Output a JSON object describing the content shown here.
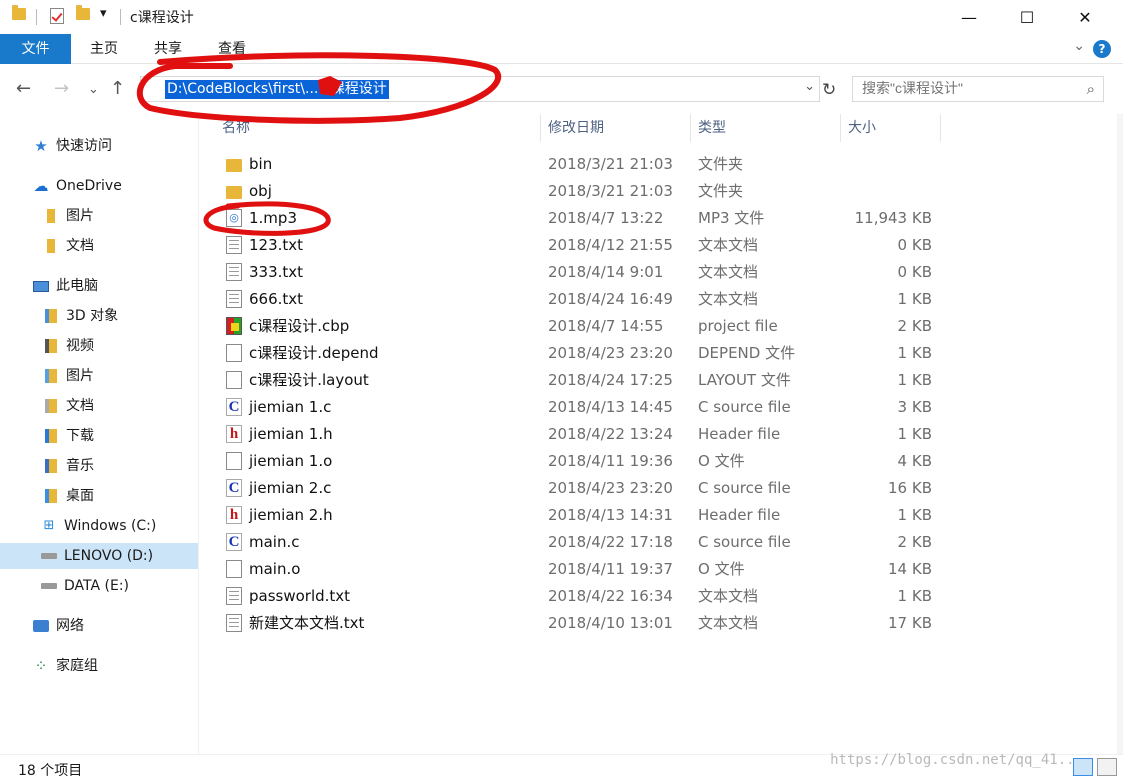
{
  "window": {
    "title": "c课程设计",
    "min": "—",
    "max": "☐",
    "close": "✕",
    "quick_access_dropdown": "▾"
  },
  "ribbon": {
    "tabs": [
      "文件",
      "主页",
      "共享",
      "查看"
    ],
    "help": "?",
    "collapse": "⌄"
  },
  "address": {
    "path": "D:\\CodeBlocks\\first\\...\\c课程设计",
    "dropdown": "⌄"
  },
  "search": {
    "placeholder": "搜索\"c课程设计\""
  },
  "sidebar": {
    "items": [
      {
        "label": "快速访问",
        "icon": "star-icon"
      },
      {
        "label": "OneDrive",
        "icon": "cloud-icon"
      },
      {
        "label": "图片",
        "icon": "folder-icon"
      },
      {
        "label": "文档",
        "icon": "folder-icon"
      },
      {
        "label": "此电脑",
        "icon": "computer-icon"
      },
      {
        "label": "3D 对象",
        "icon": "cube-folder-icon"
      },
      {
        "label": "视频",
        "icon": "video-folder-icon"
      },
      {
        "label": "图片",
        "icon": "picture-folder-icon"
      },
      {
        "label": "文档",
        "icon": "document-folder-icon"
      },
      {
        "label": "下载",
        "icon": "download-folder-icon"
      },
      {
        "label": "音乐",
        "icon": "music-folder-icon"
      },
      {
        "label": "桌面",
        "icon": "desktop-folder-icon"
      },
      {
        "label": "Windows (C:)",
        "icon": "windows-drive-icon"
      },
      {
        "label": "LENOVO (D:)",
        "icon": "drive-icon"
      },
      {
        "label": "DATA (E:)",
        "icon": "drive-icon"
      },
      {
        "label": "网络",
        "icon": "network-icon"
      },
      {
        "label": "家庭组",
        "icon": "homegroup-icon"
      }
    ]
  },
  "columns": [
    "名称",
    "修改日期",
    "类型",
    "大小"
  ],
  "files": [
    {
      "name": "bin",
      "date": "2018/3/21 21:03",
      "type": "文件夹",
      "size": "",
      "icon": "folder-icon"
    },
    {
      "name": "obj",
      "date": "2018/3/21 21:03",
      "type": "文件夹",
      "size": "",
      "icon": "folder-icon"
    },
    {
      "name": "1.mp3",
      "date": "2018/4/7 13:22",
      "type": "MP3 文件",
      "size": "11,943 KB",
      "icon": "mp3-icon"
    },
    {
      "name": "123.txt",
      "date": "2018/4/12 21:55",
      "type": "文本文档",
      "size": "0 KB",
      "icon": "text-file-icon"
    },
    {
      "name": "333.txt",
      "date": "2018/4/14 9:01",
      "type": "文本文档",
      "size": "0 KB",
      "icon": "text-file-icon"
    },
    {
      "name": "666.txt",
      "date": "2018/4/24 16:49",
      "type": "文本文档",
      "size": "1 KB",
      "icon": "text-file-icon"
    },
    {
      "name": "c课程设计.cbp",
      "date": "2018/4/7 14:55",
      "type": "project file",
      "size": "2 KB",
      "icon": "codeblocks-project-icon"
    },
    {
      "name": "c课程设计.depend",
      "date": "2018/4/23 23:20",
      "type": "DEPEND 文件",
      "size": "1 KB",
      "icon": "file-icon"
    },
    {
      "name": "c课程设计.layout",
      "date": "2018/4/24 17:25",
      "type": "LAYOUT 文件",
      "size": "1 KB",
      "icon": "file-icon"
    },
    {
      "name": "jiemian 1.c",
      "date": "2018/4/13 14:45",
      "type": "C source file",
      "size": "3 KB",
      "icon": "c-source-icon"
    },
    {
      "name": "jiemian 1.h",
      "date": "2018/4/22 13:24",
      "type": "Header file",
      "size": "1 KB",
      "icon": "header-file-icon"
    },
    {
      "name": "jiemian 1.o",
      "date": "2018/4/11 19:36",
      "type": "O 文件",
      "size": "4 KB",
      "icon": "file-icon"
    },
    {
      "name": "jiemian 2.c",
      "date": "2018/4/23 23:20",
      "type": "C source file",
      "size": "16 KB",
      "icon": "c-source-icon"
    },
    {
      "name": "jiemian 2.h",
      "date": "2018/4/13 14:31",
      "type": "Header file",
      "size": "1 KB",
      "icon": "header-file-icon"
    },
    {
      "name": "main.c",
      "date": "2018/4/22 17:18",
      "type": "C source file",
      "size": "2 KB",
      "icon": "c-source-icon"
    },
    {
      "name": "main.o",
      "date": "2018/4/11 19:37",
      "type": "O 文件",
      "size": "14 KB",
      "icon": "file-icon"
    },
    {
      "name": "passworld.txt",
      "date": "2018/4/22 16:34",
      "type": "文本文档",
      "size": "1 KB",
      "icon": "text-file-icon"
    },
    {
      "name": "新建文本文档.txt",
      "date": "2018/4/10 13:01",
      "type": "文本文档",
      "size": "17 KB",
      "icon": "text-file-icon"
    }
  ],
  "status": {
    "count": "18 个项目"
  },
  "watermark": "https://blog.csdn.net/qq_41..."
}
